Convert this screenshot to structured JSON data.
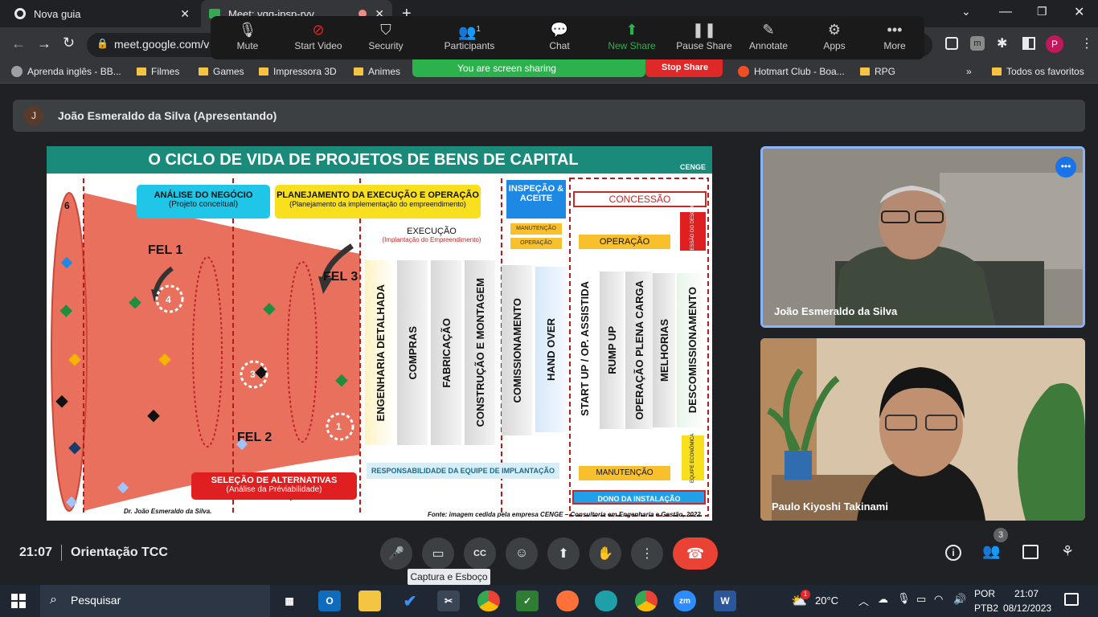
{
  "browser": {
    "tabs": [
      {
        "title": "Nova guia"
      },
      {
        "title": "Meet: vqq-ipsp-rvv"
      }
    ],
    "url": "meet.google.com/v",
    "bookmarks": [
      "Aprenda inglês - BB...",
      "Filmes",
      "Games",
      "Impressora 3D",
      "Animes",
      "Hotmart Club - Boa...",
      "RPG",
      "Todos os favoritos"
    ],
    "profile_initial": "P"
  },
  "zoom_toolbar": {
    "buttons": [
      {
        "label": "Mute",
        "icon": "microphone-icon"
      },
      {
        "label": "Start Video",
        "icon": "video-off-icon"
      },
      {
        "label": "Security",
        "icon": "shield-icon"
      },
      {
        "label": "Participants",
        "icon": "participants-icon",
        "count": "1"
      },
      {
        "label": "Chat",
        "icon": "chat-icon"
      },
      {
        "label": "New Share",
        "icon": "share-icon"
      },
      {
        "label": "Pause Share",
        "icon": "pause-icon"
      },
      {
        "label": "Annotate",
        "icon": "pen-icon"
      },
      {
        "label": "Apps",
        "icon": "apps-icon"
      },
      {
        "label": "More",
        "icon": "more-icon"
      }
    ],
    "sharing_status": "You are screen sharing",
    "stop_share": "Stop Share",
    "accent_green": "#2bb24c",
    "accent_red": "#e02828"
  },
  "meet": {
    "presenter_banner": "João Esmeraldo da Silva (Apresentando)",
    "presenter_initial": "J",
    "participants": [
      {
        "name": "João Esmeraldo da Silva"
      },
      {
        "name": "Paulo Kiyoshi Takinami"
      }
    ],
    "time": "21:07",
    "meeting_title": "Orientação TCC",
    "participant_count": "3",
    "tooltip": "Captura e Esboço"
  },
  "slide": {
    "title": "O CICLO DE VIDA DE PROJETOS DE BENS DE CAPITAL",
    "logo": "CENGE",
    "analise": {
      "title": "ANÁLISE DO NEGÓCIO",
      "subtitle": "(Projeto conceitual)"
    },
    "planejamento": {
      "title": "PLANEJAMENTO DA EXECUÇÃO E OPERAÇÃO",
      "subtitle": "(Planejamento da implementação do empreendimento)"
    },
    "selecao": {
      "title": "SELEÇÃO DE ALTERNATIVAS",
      "subtitle": "(Análise da Préviabilidade)"
    },
    "execucao": {
      "title": "EXECUÇÃO",
      "subtitle": "(Implantação do Empreendimento)"
    },
    "inspecao": "INSPEÇÃO & ACEITE",
    "concessao": "CONCESSÃO",
    "manutencao_small": "MANUTENÇÃO",
    "operacao_small": "OPERAÇÃO",
    "operacao": "OPERAÇÃO",
    "concessao_vertical": "CONCESSÃO DO DESCOMIS",
    "fel1": "FEL 1",
    "fel2": "FEL 2",
    "fel3": "FEL 3",
    "numbers": [
      "6",
      "4",
      "3",
      "1"
    ],
    "phases": [
      "ENGENHARIA DETALHADA",
      "COMPRAS",
      "FABRICAÇÃO",
      "CONSTRUÇÃO E MONTAGEM",
      "COMISSIONAMENTO",
      "HAND OVER",
      "START UP / OP. ASSISTIDA",
      "RUMP UP",
      "OPERAÇÃO PLENA CARGA",
      "MELHORIAS",
      "DESCOMISSIONAMENTO"
    ],
    "responsabilidade": "RESPONSABILIDADE DA EQUIPE DE IMPLANTAÇÃO",
    "manutencao": "MANUTENÇÃO",
    "equipe_economica": "EQUIPE ECONÔMICA",
    "dono": "DONO DA INSTALAÇÃO",
    "author": "Dr. João Esmeraldo da Silva.",
    "source": "Fonte: imagem cedida pela empresa CENGE – Consultoria em Engenharia e Gestão, 2022."
  },
  "taskbar": {
    "search_placeholder": "Pesquisar",
    "weather": "20°C",
    "weather_badge": "1",
    "lang": "POR",
    "layout": "PTB2",
    "clock_time": "21:07",
    "clock_date": "08/12/2023"
  }
}
